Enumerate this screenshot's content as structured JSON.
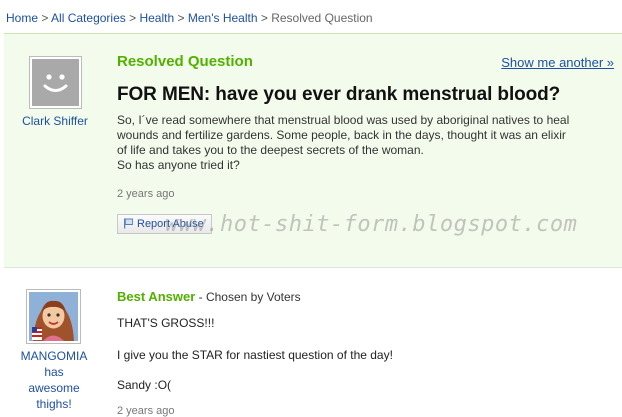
{
  "breadcrumb": {
    "items": [
      "Home",
      "All Categories",
      "Health",
      "Men's Health"
    ],
    "current": "Resolved Question",
    "separator": ">"
  },
  "question": {
    "status_label": "Resolved Question",
    "show_another": "Show me another »",
    "asker": "Clark Shiffer",
    "title": "FOR MEN: have you ever drank menstrual blood?",
    "body_lines": [
      "So, I´ve read somewhere that menstrual blood was used by aboriginal natives to heal",
      "wounds and fertilize gardens. Some people, back in the days, thought it was an elixir",
      "of life and takes you to the deepest secrets of the woman.",
      "So has anyone tried it?"
    ],
    "time": "2 years ago",
    "report_label": "Report Abuse"
  },
  "watermark": "www.hot-shit-form.blogspot.com",
  "answer": {
    "best_label": "Best Answer",
    "chosen_by": " - Chosen by Voters",
    "answerer_lines": [
      "MANGOMIA",
      "has",
      "awesome",
      "thighs!"
    ],
    "lines": [
      "THAT'S GROSS!!!",
      "I give you the STAR for nastiest question of the day!",
      "Sandy :O("
    ],
    "time": "2 years ago"
  }
}
